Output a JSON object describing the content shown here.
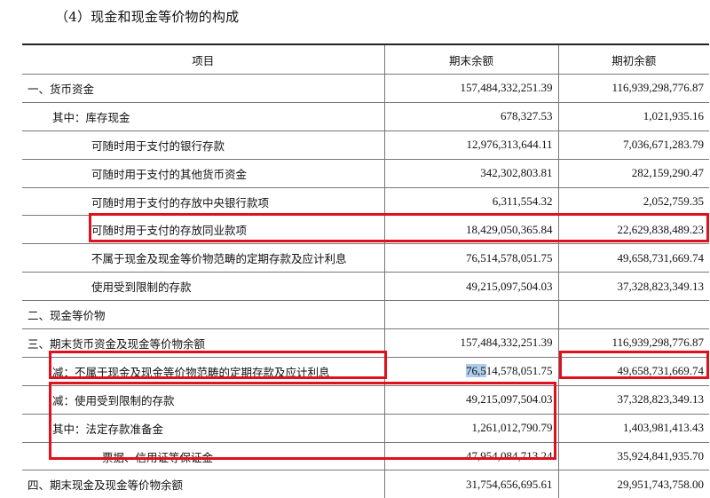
{
  "title": "（4）现金和现金等价物的构成",
  "columns": [
    "项目",
    "期末余额",
    "期初余额"
  ],
  "rows": [
    {
      "label": "一、货币资金",
      "end": "157,484,332,251.39",
      "begin": "116,939,298,776.87"
    },
    {
      "label": "其中：库存现金",
      "end": "678,327.53",
      "begin": "1,021,935.16"
    },
    {
      "label": "可随时用于支付的银行存款",
      "end": "12,976,313,644.11",
      "begin": "7,036,671,283.79"
    },
    {
      "label": "可随时用于支付的其他货币资金",
      "end": "342,302,803.81",
      "begin": "282,159,290.47"
    },
    {
      "label": "可随时用于支付的存放中央银行款项",
      "end": "6,311,554.32",
      "begin": "2,052,759.35"
    },
    {
      "label": "可随时用于支付的存放同业款项",
      "end": "18,429,050,365.84",
      "begin": "22,629,838,489.23"
    },
    {
      "label": "不属于现金及现金等价物范畴的定期存款及应计利息",
      "end": "76,514,578,051.75",
      "begin": "49,658,731,669.74"
    },
    {
      "label": "使用受到限制的存款",
      "end": "49,215,097,504.03",
      "begin": "37,328,823,349.13"
    },
    {
      "label": "二、现金等价物",
      "end": "",
      "begin": ""
    },
    {
      "label": "三、期末货币资金及现金等价物余额",
      "end": "157,484,332,251.39",
      "begin": "116,939,298,776.87"
    },
    {
      "label": "减：不属于现金及现金等价物范畴的定期存款及应计利息",
      "end_selected": "76,5",
      "end_rest": "14,578,051.75",
      "begin": "49,658,731,669.74"
    },
    {
      "label": "减：使用受到限制的存款",
      "end": "49,215,097,504.03",
      "begin": "37,328,823,349.13"
    },
    {
      "label": "其中：法定存款准备金",
      "end": "1,261,012,790.79",
      "begin": "1,403,981,413.43"
    },
    {
      "label": "票据、信用证等保证金",
      "end": "47,954,084,713.24",
      "begin": "35,924,841,935.70"
    },
    {
      "label": "四、期末现金及现金等价物余额",
      "end": "31,754,656,695.61",
      "begin": "29,951,743,758.00"
    }
  ],
  "colors": {
    "annotation_red": "#e0101d",
    "selection_blue": "#aecbea"
  }
}
